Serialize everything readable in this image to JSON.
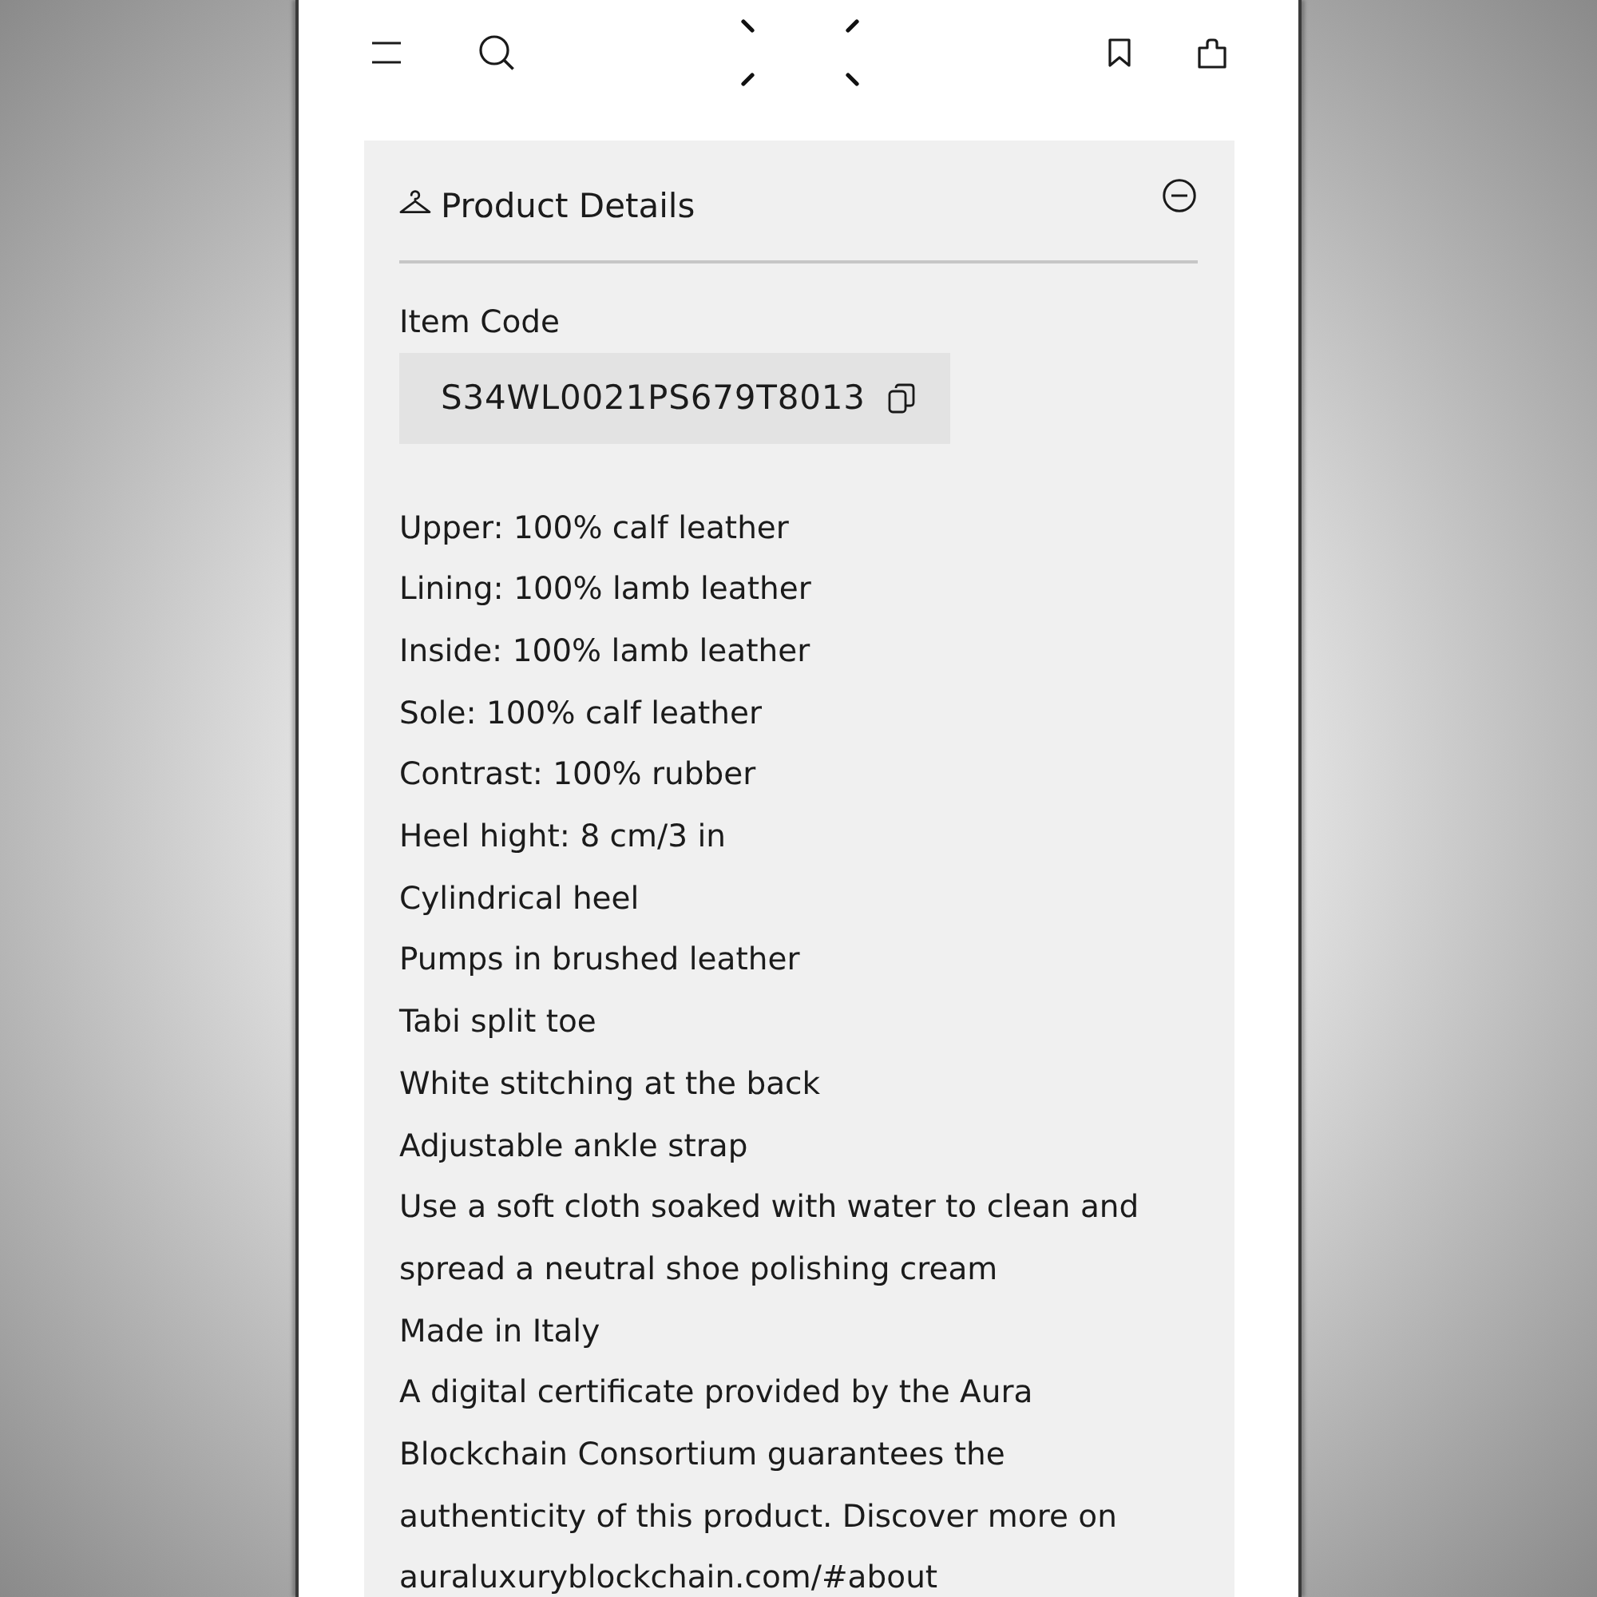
{
  "product_details": {
    "title": "Product Details",
    "expanded": true,
    "item_code": {
      "label": "Item Code",
      "value": "S34WL0021PS679T8013"
    },
    "details": [
      "Upper: 100% calf leather",
      "Lining: 100% lamb leather",
      "Inside: 100% lamb leather",
      "Sole: 100% calf leather",
      "Contrast: 100% rubber",
      "Heel hight: 8 cm/3 in",
      "Cylindrical heel",
      "Pumps in brushed leather",
      "Tabi split toe",
      "White stitching at the back",
      "Adjustable ankle strap",
      "Use a soft cloth soaked with water to clean and spread a neutral shoe polishing cream",
      "Made in Italy",
      "A digital certificate provided by the Aura Blockchain Consortium guarantees the authenticity of this product. Discover more on auraluxuryblockchain.com/#about"
    ]
  }
}
